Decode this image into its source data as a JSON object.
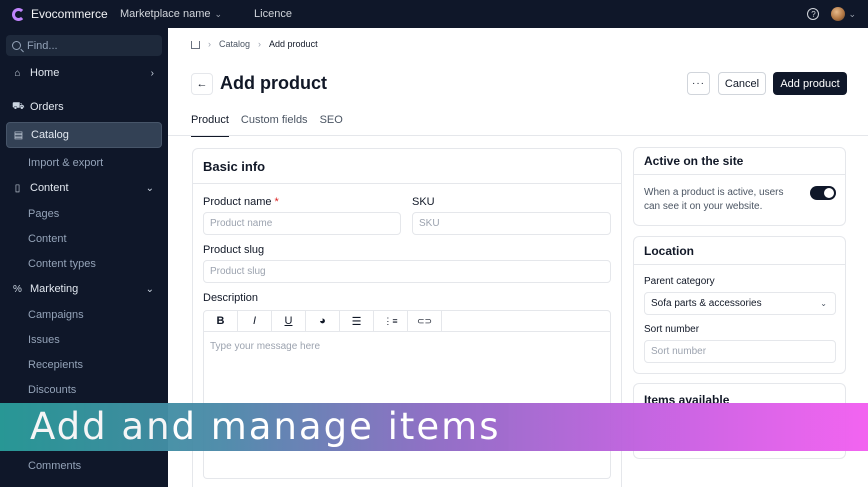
{
  "topbar": {
    "brand": "Evocommerce",
    "marketplace": "Marketplace name",
    "licence": "Licence"
  },
  "sidebar": {
    "search_placeholder": "Find...",
    "items": {
      "home": "Home",
      "orders": "Orders",
      "catalog": "Catalog",
      "import_export": "Import & export",
      "content": "Content",
      "pages": "Pages",
      "content_sub": "Content",
      "content_types": "Content types",
      "marketing": "Marketing",
      "campaigns": "Campaigns",
      "issues": "Issues",
      "recepients": "Recepients",
      "discounts": "Discounts",
      "comments": "Comments"
    }
  },
  "breadcrumb": {
    "catalog": "Catalog",
    "current": "Add product"
  },
  "header": {
    "title": "Add product",
    "more_label": "···",
    "cancel_label": "Cancel",
    "primary_label": "Add product"
  },
  "tabs": [
    "Product",
    "Custom fields",
    "SEO"
  ],
  "basic_info": {
    "title": "Basic info",
    "product_name_label": "Product name",
    "required_mark": "*",
    "product_name_placeholder": "Product name",
    "sku_label": "SKU",
    "sku_placeholder": "SKU",
    "slug_label": "Product slug",
    "slug_placeholder": "Product slug",
    "description_label": "Description",
    "editor_placeholder": "Type your message here"
  },
  "editor_tools": {
    "bold": "B",
    "italic": "I",
    "underline": "U",
    "palette": "◕",
    "bullet_list": "☰",
    "ordered_list": "⋮≡",
    "link": "⊂⊃"
  },
  "active_card": {
    "title": "Active on the site",
    "description": "When a product is active, users can see it on your website.",
    "active": true
  },
  "location_card": {
    "title": "Location",
    "parent_category_label": "Parent category",
    "parent_category_value": "Sofa parts & accessories",
    "sort_number_label": "Sort number",
    "sort_number_placeholder": "Sort number"
  },
  "items_card": {
    "title": "Items available"
  },
  "banner": {
    "text": "Add and manage items"
  },
  "colors": {
    "dark_navy": "#0f1729",
    "banner_start": "#2a9d9a",
    "banner_end": "#f25ef0"
  }
}
